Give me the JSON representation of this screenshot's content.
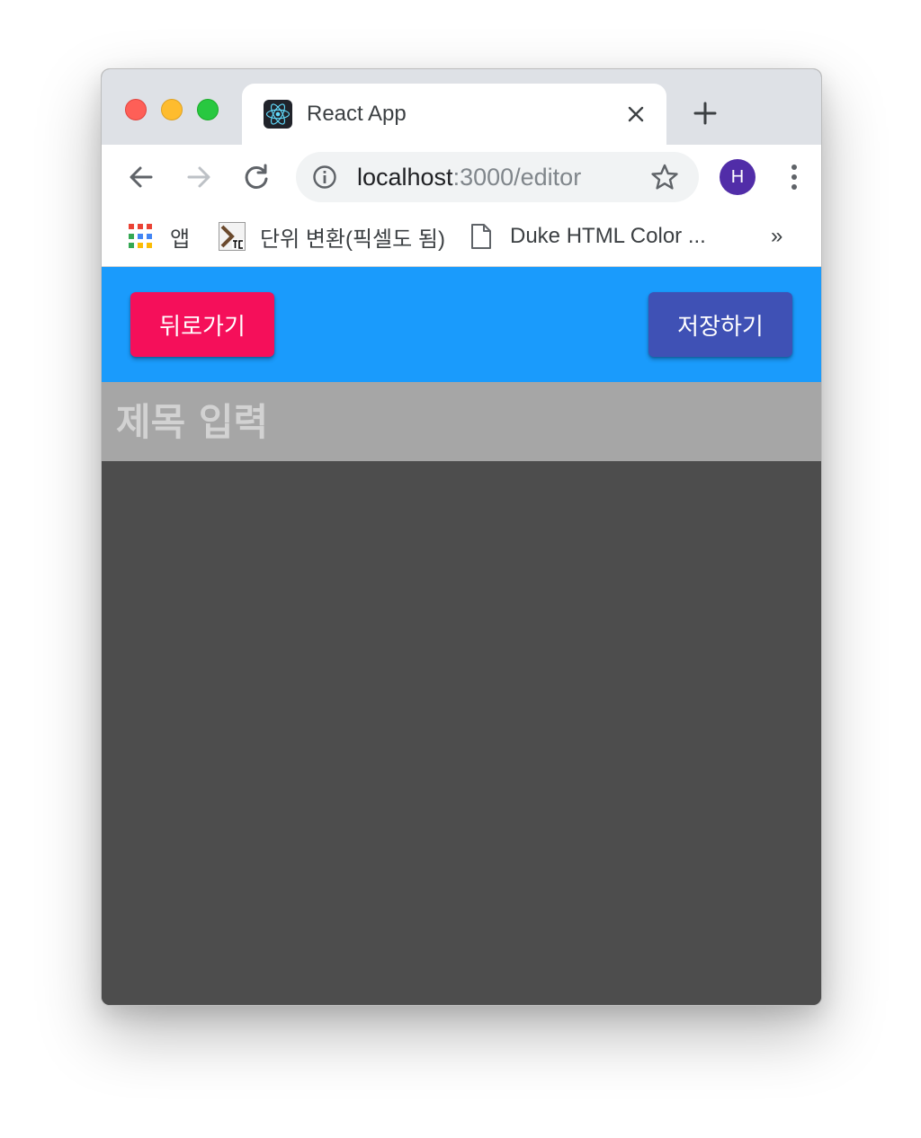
{
  "browser": {
    "tab": {
      "title": "React App",
      "favicon": "react-logo-icon"
    },
    "url": {
      "host": "localhost",
      "path": ":3000/editor"
    },
    "profile_initial": "H",
    "bookmarks": [
      {
        "label": "앱",
        "icon": "apps-grid-icon"
      },
      {
        "label": "단위 변환(픽셀도 됨)",
        "icon": "site-favicon"
      },
      {
        "label": "Duke HTML Color ...",
        "icon": "document-icon"
      }
    ],
    "more_bookmarks": "»"
  },
  "app": {
    "back_button": "뒤로가기",
    "save_button": "저장하기",
    "title_placeholder": "제목 입력",
    "colors": {
      "header": "#1a9bfc",
      "back_button": "#f50f5a",
      "save_button": "#3f51b5",
      "title_bar": "#a6a6a6",
      "editor": "#4d4d4d"
    }
  }
}
